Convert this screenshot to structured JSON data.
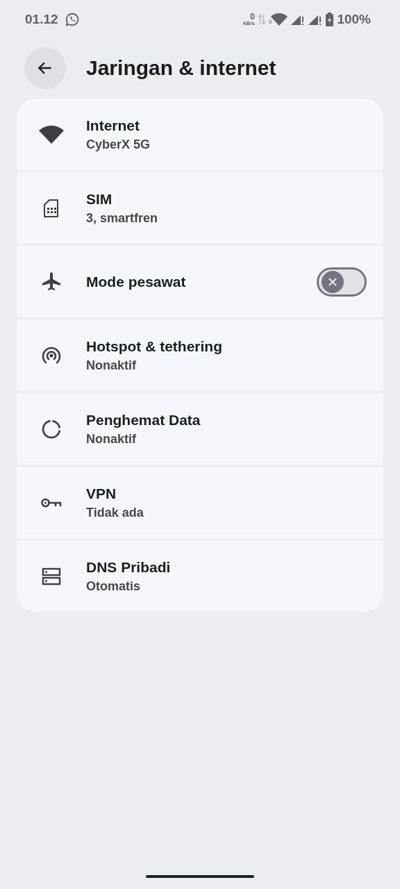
{
  "status_bar": {
    "time": "01.12",
    "net_speed": "0",
    "net_unit": "kB/s",
    "wifi_label": "5",
    "battery": "100%"
  },
  "header": {
    "title": "Jaringan & internet"
  },
  "items": [
    {
      "kind": "link",
      "title": "Internet",
      "subtitle": "CyberX 5G"
    },
    {
      "kind": "link",
      "title": "SIM",
      "subtitle": "3, smartfren"
    },
    {
      "kind": "toggle",
      "title": "Mode pesawat",
      "on": false
    },
    {
      "kind": "link",
      "title": "Hotspot & tethering",
      "subtitle": "Nonaktif"
    },
    {
      "kind": "link",
      "title": "Penghemat Data",
      "subtitle": "Nonaktif"
    },
    {
      "kind": "link",
      "title": "VPN",
      "subtitle": "Tidak ada"
    },
    {
      "kind": "link",
      "title": "DNS Pribadi",
      "subtitle": "Otomatis"
    }
  ]
}
